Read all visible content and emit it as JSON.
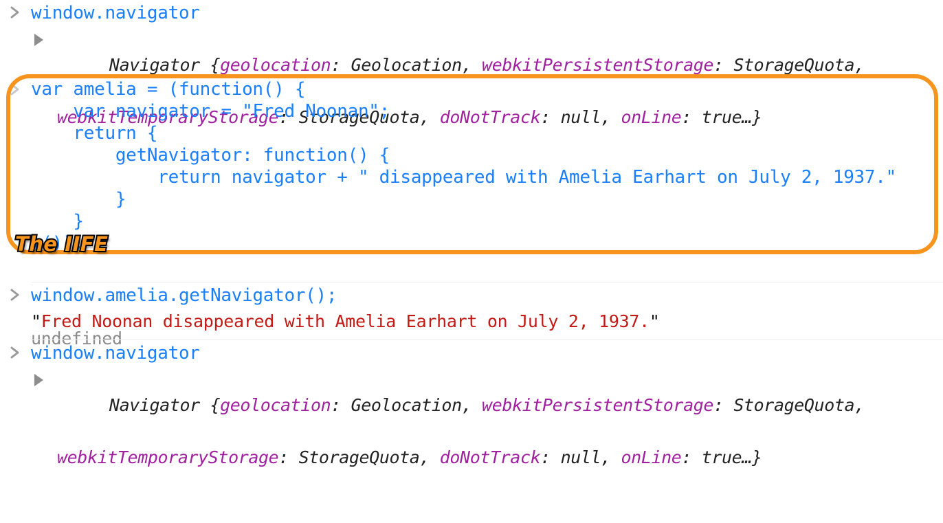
{
  "console": {
    "prompt_symbol": ">",
    "colors": {
      "input_blue": "#1a7ffb",
      "highlight_orange": "#f7941e",
      "string_red": "#c41a16",
      "key_purple": "#a020a0",
      "muted_gray": "#8a8a8a",
      "separator": "#ededed"
    },
    "entries": [
      {
        "id": "entry-1",
        "input": "window.navigator",
        "output_type": "object-preview",
        "object": {
          "constructor": "Navigator",
          "open_brace": "{",
          "properties": [
            {
              "key": "geolocation",
              "value": "Geolocation"
            },
            {
              "key": "webkitPersistentStorage",
              "value": "StorageQuota"
            },
            {
              "key": "webkitTemporaryStorage",
              "value": "StorageQuota"
            },
            {
              "key": "doNotTrack",
              "value": "null"
            },
            {
              "key": "onLine",
              "value": "true"
            }
          ],
          "ellipsis": "…",
          "close_brace": "}",
          "line1": "Navigator {geolocation: Geolocation, webkitPersistentStorage: StorageQuota,",
          "line2": "webkitTemporaryStorage: StorageQuota, doNotTrack: null, onLine: true…}"
        }
      },
      {
        "id": "entry-2",
        "input_lines": [
          "var amelia = (function() {",
          "    var navigator = \"Fred Noonan\";",
          "    return {",
          "        getNavigator: function() {",
          "            return navigator + \" disappeared with Amelia Earhart on July 2, 1937.\"",
          "        }",
          "    }",
          "}());"
        ],
        "annotation_badge": "The IIFE",
        "output": "undefined"
      },
      {
        "id": "entry-3",
        "input": "window.amelia.getNavigator();",
        "output_string": "Fred Noonan disappeared with Amelia Earhart on July 2, 1937.",
        "output_quote": "\""
      },
      {
        "id": "entry-4",
        "input": "window.navigator",
        "output_type": "object-preview",
        "object": {
          "line1": "Navigator {geolocation: Geolocation, webkitPersistentStorage: StorageQuota,",
          "line2": "webkitTemporaryStorage: StorageQuota, doNotTrack: null, onLine: true…}"
        }
      }
    ]
  }
}
